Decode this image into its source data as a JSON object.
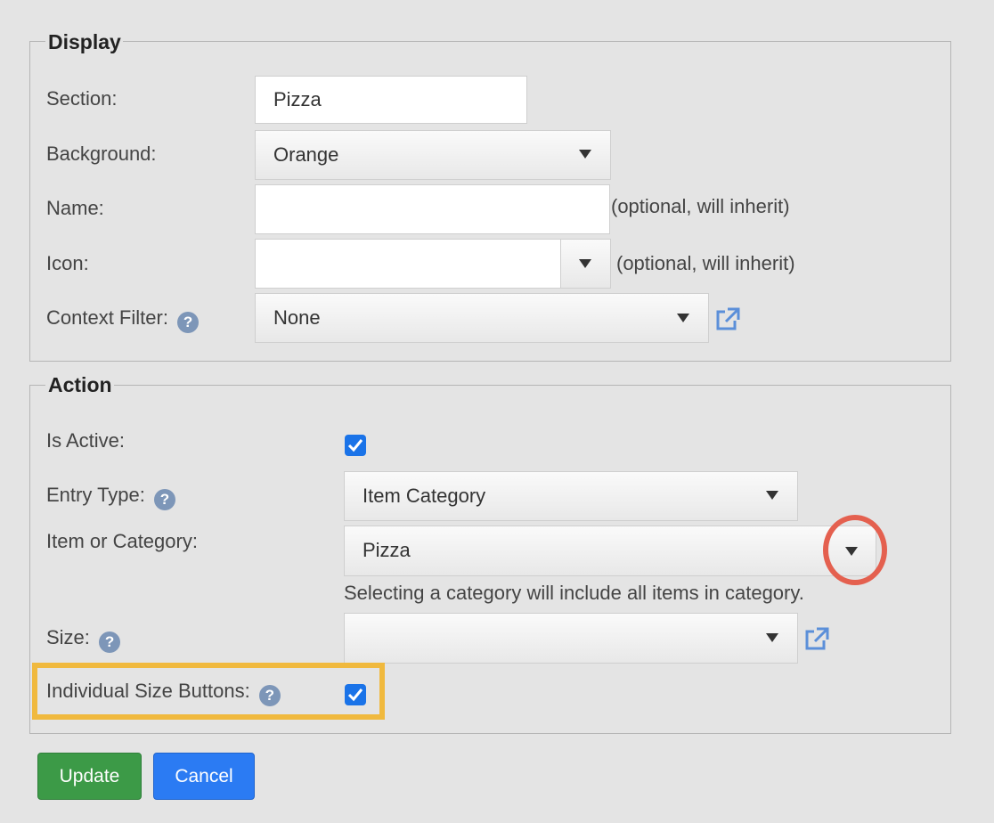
{
  "display": {
    "legend": "Display",
    "section": {
      "label": "Section:",
      "value": "Pizza"
    },
    "background": {
      "label": "Background:",
      "value": "Orange"
    },
    "name": {
      "label": "Name:",
      "value": "",
      "note": "(optional, will inherit)"
    },
    "icon": {
      "label": "Icon:",
      "value": "",
      "note": "(optional, will inherit)"
    },
    "context_filter": {
      "label": "Context Filter:",
      "value": "None",
      "help": "?"
    }
  },
  "action": {
    "legend": "Action",
    "is_active": {
      "label": "Is Active:",
      "checked": true
    },
    "entry_type": {
      "label": "Entry Type:",
      "value": "Item Category",
      "help": "?"
    },
    "item_or_category": {
      "label": "Item or Category:",
      "value": "Pizza",
      "hint": "Selecting a category will include all items in category."
    },
    "size": {
      "label": "Size:",
      "value": "",
      "help": "?"
    },
    "individual_size_buttons": {
      "label": "Individual Size Buttons:",
      "checked": true,
      "help": "?"
    }
  },
  "buttons": {
    "update_label": "Update",
    "cancel_label": "Cancel"
  },
  "icons": {
    "help": "help-icon",
    "external": "external-link-icon",
    "dropdown": "chevron-down-icon",
    "check": "check-icon"
  },
  "colors": {
    "update_button": "#3c9a47",
    "cancel_button": "#2b7bf3",
    "checkbox": "#1a73e8",
    "highlight_box": "#f0b93e",
    "highlight_circle": "#e4604f"
  }
}
